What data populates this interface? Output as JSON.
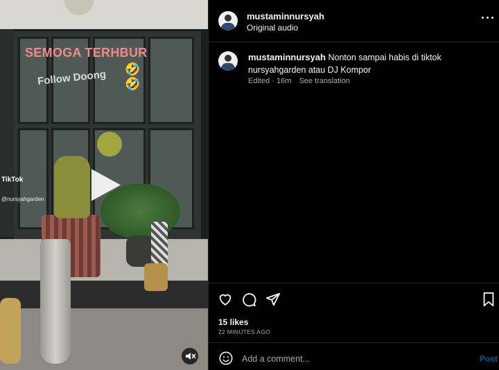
{
  "video": {
    "overlay_text_1": "SEMOGA TERHBUR",
    "overlay_text_2": "Follow Doong",
    "overlay_emoji": "🤣🤣",
    "tiktok_label": "TikTok",
    "tiktok_user": "@nursyahgarden",
    "play_icon": "play-icon",
    "mute_icon": "speaker-muted-icon"
  },
  "header": {
    "username": "mustaminnursyah",
    "audio": "Original audio",
    "more_icon": "more-horizontal-icon"
  },
  "caption": {
    "username": "mustaminnursyah",
    "text": "Nonton sampai habis di tiktok nursyahgarden atau DJ Kompor",
    "edited": "Edited · 16m",
    "translate": "See translation"
  },
  "actions": {
    "like_icon": "heart-icon",
    "comment_icon": "comment-icon",
    "share_icon": "share-icon",
    "save_icon": "bookmark-icon"
  },
  "stats": {
    "likes": "15 likes",
    "time": "22 MINUTES AGO"
  },
  "comment": {
    "emoji_icon": "emoji-icon",
    "placeholder": "Add a comment...",
    "post_label": "Post"
  },
  "colors": {
    "background": "#000000",
    "divider": "#262626",
    "secondary_text": "#a8a8a8",
    "post_disabled": "#0c5a8c"
  }
}
